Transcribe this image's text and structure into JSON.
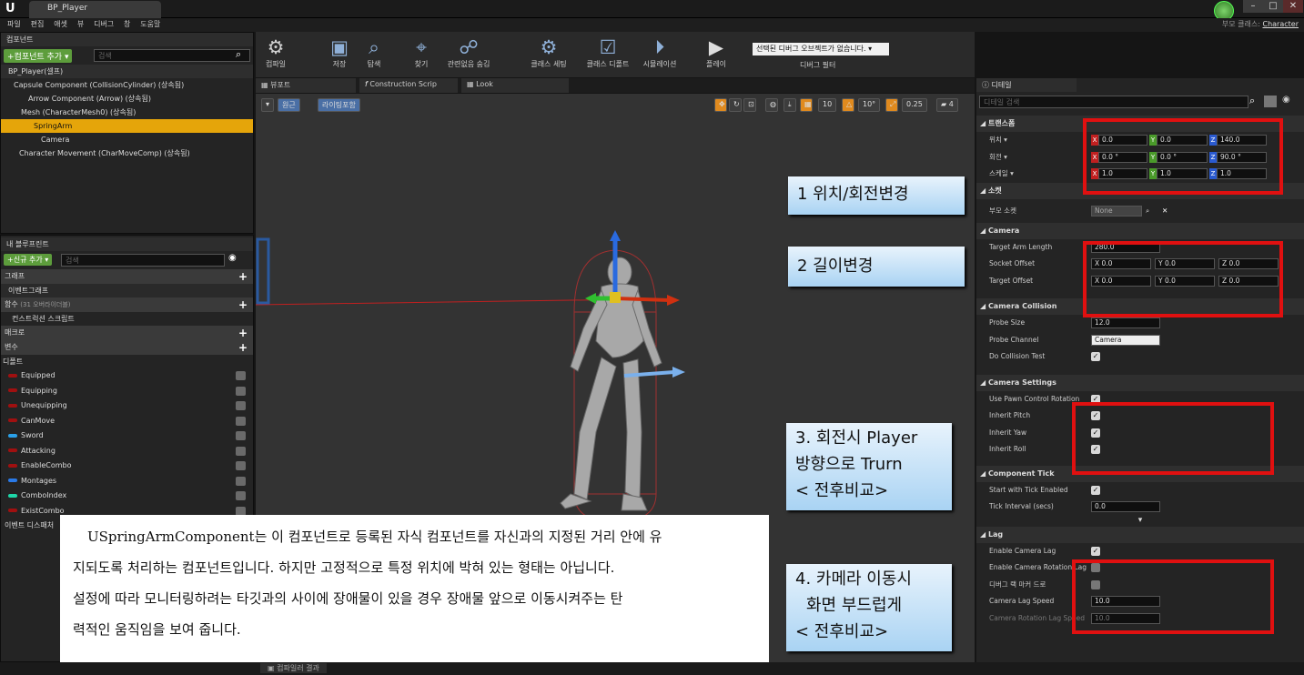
{
  "window": {
    "logo": "U",
    "doc_tab": "BP_Player",
    "parent_class_label": "부모 클래스:",
    "parent_class_value": "Character",
    "minimize": "–",
    "maximize": "□",
    "close": "✕"
  },
  "menu": [
    "파일",
    "편집",
    "애셋",
    "뷰",
    "디버그",
    "창",
    "도움말"
  ],
  "components": {
    "tab": "컴포넌트",
    "add_button": "+컴포넌트 추가 ▾",
    "search_placeholder": "검색",
    "root": "BP_Player(셀프)",
    "items": [
      "Capsule Component (CollisionCylinder) (상속됨)",
      "Arrow Component (Arrow) (상속됨)",
      "Mesh (CharacterMesh0) (상속됨)",
      "SpringArm",
      "Camera",
      "Character Movement (CharMoveComp) (상속됨)"
    ]
  },
  "myblueprint": {
    "tab": "내 블루프린트",
    "add_button": "+신규 추가 ▾",
    "search_placeholder": "검색",
    "sections": {
      "graph": "그래프",
      "event_graph": "이벤트그래프",
      "functions": "함수",
      "functions_count": "(31 오버라이더블)",
      "construction": "컨스트럭션 스크립트",
      "macros": "매크로",
      "variables": "변수",
      "default": "디폴트",
      "dispatchers": "이벤트 디스패처"
    },
    "variables": [
      {
        "name": "Equipped",
        "color": "#a01010"
      },
      {
        "name": "Equipping",
        "color": "#a01010"
      },
      {
        "name": "Unequipping",
        "color": "#a01010"
      },
      {
        "name": "CanMove",
        "color": "#a01010"
      },
      {
        "name": "Sword",
        "color": "#2aa0e8"
      },
      {
        "name": "Attacking",
        "color": "#a01010"
      },
      {
        "name": "EnableCombo",
        "color": "#a01010"
      },
      {
        "name": "Montages",
        "color": "#2a7ae8"
      },
      {
        "name": "ComboIndex",
        "color": "#1ed6a8"
      },
      {
        "name": "ExistCombo",
        "color": "#a01010"
      }
    ]
  },
  "toolbar": [
    {
      "label": "컴파일",
      "icon": "compile-icon"
    },
    {
      "label": "저장",
      "icon": "save-icon"
    },
    {
      "label": "탐색",
      "icon": "browse-icon"
    },
    {
      "label": "찾기",
      "icon": "find-icon"
    },
    {
      "label": "관련없음 숨김",
      "icon": "hide-unrelated-icon"
    },
    {
      "label": "클래스 세팅",
      "icon": "class-settings-icon"
    },
    {
      "label": "클래스 디폴트",
      "icon": "class-defaults-icon"
    },
    {
      "label": "시뮬레이션",
      "icon": "simulation-icon"
    },
    {
      "label": "플레이",
      "icon": "play-icon"
    }
  ],
  "debug": {
    "select": "선택된 디버그 오브젝트가 없습니다.",
    "label": "디버그 필터"
  },
  "viewport_tabs": [
    "뷰포트",
    "Construction Scrip",
    "Look"
  ],
  "viewport_buttons": {
    "perspective": "원근",
    "lighting": "라이팅포함",
    "grid": "10",
    "angle": "10°",
    "scale": "0.25",
    "cam": "4"
  },
  "details": {
    "tab": "디테일",
    "search_placeholder": "디테일 검색",
    "transform": {
      "title": "트랜스폼",
      "location_label": "위치 ▾",
      "rotation_label": "회전 ▾",
      "scale_label": "스케일 ▾",
      "location": [
        "0.0",
        "0.0",
        "140.0"
      ],
      "rotation": [
        "0.0 °",
        "0.0 °",
        "90.0 °"
      ],
      "scale": [
        "1.0",
        "1.0",
        "1.0"
      ]
    },
    "socket": {
      "title": "소켓",
      "parent_socket_label": "부모 소켓",
      "parent_socket_value": "None"
    },
    "camera": {
      "title": "Camera",
      "arm_length_label": "Target Arm Length",
      "arm_length": "280.0",
      "socket_offset_label": "Socket Offset",
      "socket_offset": [
        "X 0.0",
        "Y 0.0",
        "Z 0.0"
      ],
      "target_offset_label": "Target Offset",
      "target_offset": [
        "X 0.0",
        "Y 0.0",
        "Z 0.0"
      ]
    },
    "collision": {
      "title": "Camera Collision",
      "probe_size_label": "Probe Size",
      "probe_size": "12.0",
      "probe_channel_label": "Probe Channel",
      "probe_channel": "Camera",
      "do_test_label": "Do Collision Test"
    },
    "settings": {
      "title": "Camera Settings",
      "use_pawn": "Use Pawn Control Rotation",
      "pitch": "Inherit Pitch",
      "yaw": "Inherit Yaw",
      "roll": "Inherit Roll"
    },
    "tick": {
      "title": "Component Tick",
      "start": "Start with Tick Enabled",
      "interval_label": "Tick Interval (secs)",
      "interval": "0.0"
    },
    "lag": {
      "title": "Lag",
      "enable": "Enable Camera Lag",
      "enable_rot": "Enable Camera Rotation Lag",
      "debug": "디버그 랙 마커 드로",
      "speed_label": "Camera Lag Speed",
      "speed": "10.0",
      "rot_speed_label": "Camera Rotation Lag Speed",
      "rot_speed": "10.0"
    }
  },
  "callouts": {
    "c1": "1 위치/회전변경",
    "c2": "2 길이변경",
    "c3_line1": "3. 회전시 Player",
    "c3_line2": "방향으로 Trurn",
    "c3_line3": "< 전후비교>",
    "c4_line1": "4. 카메라 이동시",
    "c4_line2": "화면 부드럽게",
    "c4_line3": "< 전후비교>"
  },
  "description": {
    "line1": "USpringArmComponent는 이 컴포넌트로 등록된 자식 컴포넌트를 자신과의 지정된 거리 안에 유",
    "line2": "지되도록 처리하는 컴포넌트입니다. 하지만 고정적으로 특정 위치에 박혀 있는 형태는 아닙니다.",
    "line3": "설정에 따라 모니터링하려는 타깃과의 사이에 장애물이 있을 경우 장애물 앞으로 이동시켜주는 탄",
    "line4": "력적인 움직임을 보여 줍니다."
  },
  "bottom_tab": "컴파일러 결과"
}
